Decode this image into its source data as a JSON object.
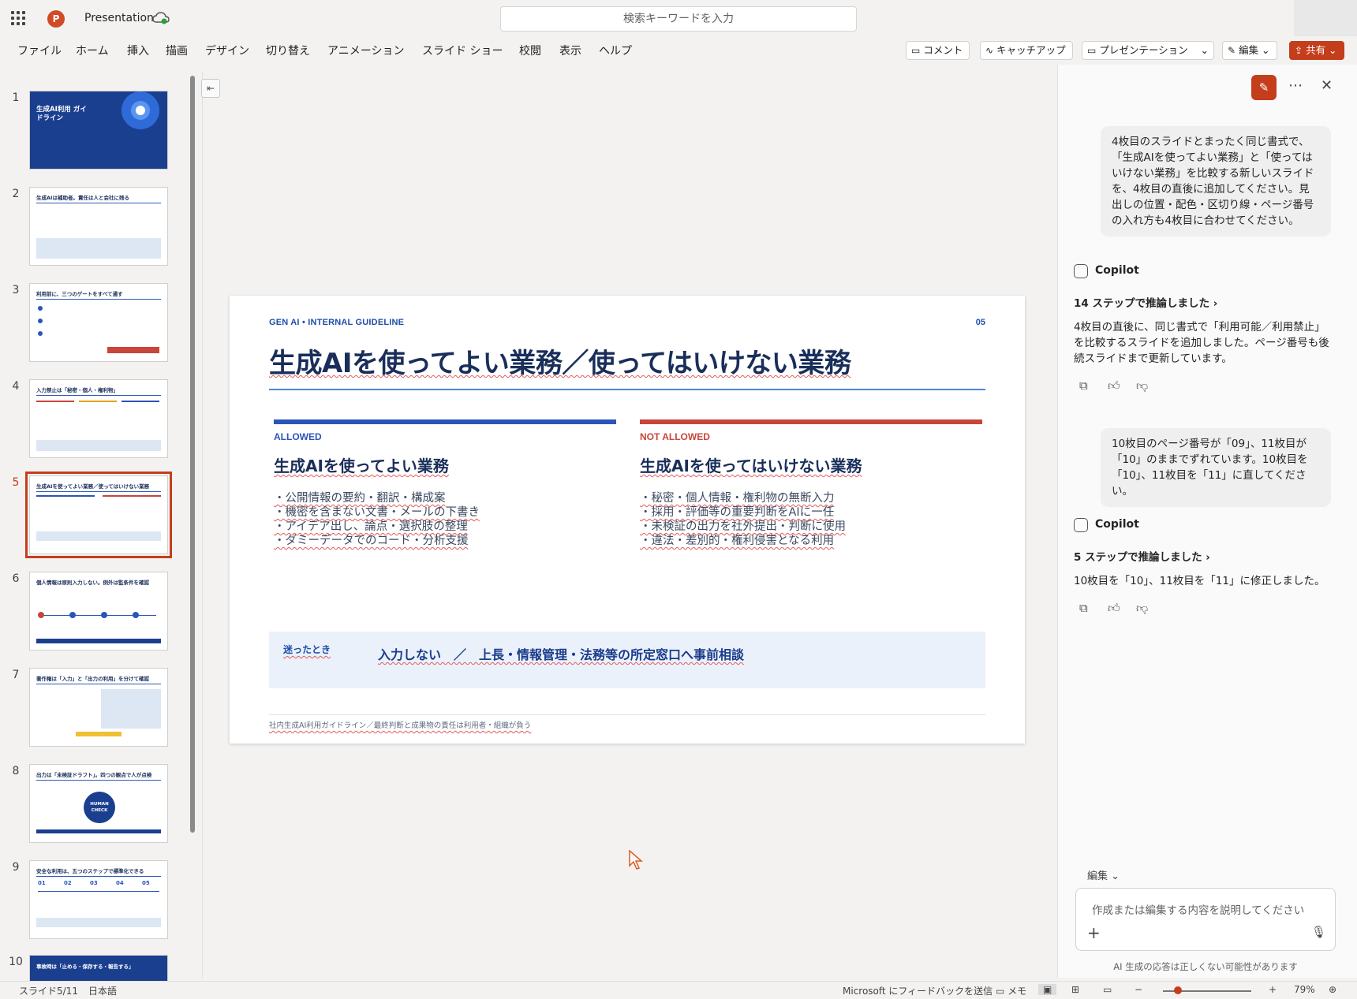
{
  "app": {
    "title": "Presentation",
    "search_placeholder": "検索キーワードを入力",
    "accent_color": "#c43e1c"
  },
  "menu": [
    "ファイル",
    "ホーム",
    "挿入",
    "描画",
    "デザイン",
    "切り替え",
    "アニメーション",
    "スライド ショー",
    "校閲",
    "表示",
    "ヘルプ"
  ],
  "ribbon_buttons": {
    "comment": "コメント",
    "catchup": "キャッチアップ",
    "present": "プレゼンテーション",
    "edit": "編集",
    "share": "共有"
  },
  "thumbnails": [
    {
      "num": "1",
      "title": "生成AI利用 ガイドライン"
    },
    {
      "num": "2",
      "title": "生成AIは補助者。責任は人と会社に残る"
    },
    {
      "num": "3",
      "title": "利用前に、三つのゲートをすべて通す"
    },
    {
      "num": "4",
      "title": "入力禁止は「秘密・個人・権利物」"
    },
    {
      "num": "5",
      "title": "生成AIを使ってよい業務／使ってはいけない業務"
    },
    {
      "num": "6",
      "title": "個人情報は原則入力しない。例外は監条件を確認"
    },
    {
      "num": "7",
      "title": "著作権は「入力」と「出力の利用」を分けて確認"
    },
    {
      "num": "8",
      "title": "出力は「未検証ドラフト」。四つの観点で人が点検",
      "badge": "HUMAN CHECK"
    },
    {
      "num": "9",
      "title": "安全な利用は、五つのステップで標準化できる",
      "steps": [
        "01",
        "02",
        "03",
        "04",
        "05"
      ]
    },
    {
      "num": "10",
      "title": "事故時は「止める・保存する・報告する」"
    }
  ],
  "slide": {
    "eyebrow": "GEN AI • INTERNAL GUIDELINE",
    "page_number": "05",
    "title": "生成AIを使ってよい業務／使ってはいけない業務",
    "allowed": {
      "label": "ALLOWED",
      "title": "生成AIを使ってよい業務",
      "items": [
        "・公開情報の要約・翻訳・構成案",
        "・機密を含まない文書・メールの下書き",
        "・アイデア出し、論点・選択肢の整理",
        "・ダミーデータでのコード・分析支援"
      ],
      "color": "#2a55b8"
    },
    "not_allowed": {
      "label": "NOT ALLOWED",
      "title": "生成AIを使ってはいけない業務",
      "items": [
        "・秘密・個人情報・権利物の無断入力",
        "・採用・評価等の重要判断をAIに一任",
        "・未検証の出力を社外提出・判断に使用",
        "・違法・差別的・権利侵害となる利用"
      ],
      "color": "#c8453c"
    },
    "callout_label": "迷ったとき",
    "callout_text": "入力しない　／　上長・情報管理・法務等の所定窓口へ事前相談",
    "footer": "社内生成AI利用ガイドライン／最終判断と成果物の責任は利用者・組織が負う"
  },
  "copilot": {
    "name": "Copilot",
    "messages": [
      {
        "role": "user",
        "text": "4枚目のスライドとまったく同じ書式で、「生成AIを使ってよい業務」と「使ってはいけない業務」を比較する新しいスライドを、4枚目の直後に追加してください。見出しの位置・配色・区切り線・ページ番号の入れ方も4枚目に合わせてください。"
      },
      {
        "role": "assistant",
        "reasoning": "14 ステップで推論しました",
        "text": "4枚目の直後に、同じ書式で「利用可能／利用禁止」を比較するスライドを追加しました。ページ番号も後続スライドまで更新しています。"
      },
      {
        "role": "user",
        "text": "10枚目のページ番号が「09」、11枚目が「10」のままでずれています。10枚目を「10」、11枚目を「11」に直してください。"
      },
      {
        "role": "assistant",
        "reasoning": "5 ステップで推論しました",
        "text": "10枚目を「10」、11枚目を「11」に修正しました。"
      }
    ],
    "mode": "編集",
    "input_placeholder": "作成または編集する内容を説明してください",
    "disclaimer": "AI 生成の応答は正しくない可能性があります"
  },
  "status": {
    "slide_info": "スライド5/11",
    "language": "日本語",
    "feedback": "Microsoft にフィードバックを送信",
    "notes": "メモ",
    "zoom": "79%"
  }
}
